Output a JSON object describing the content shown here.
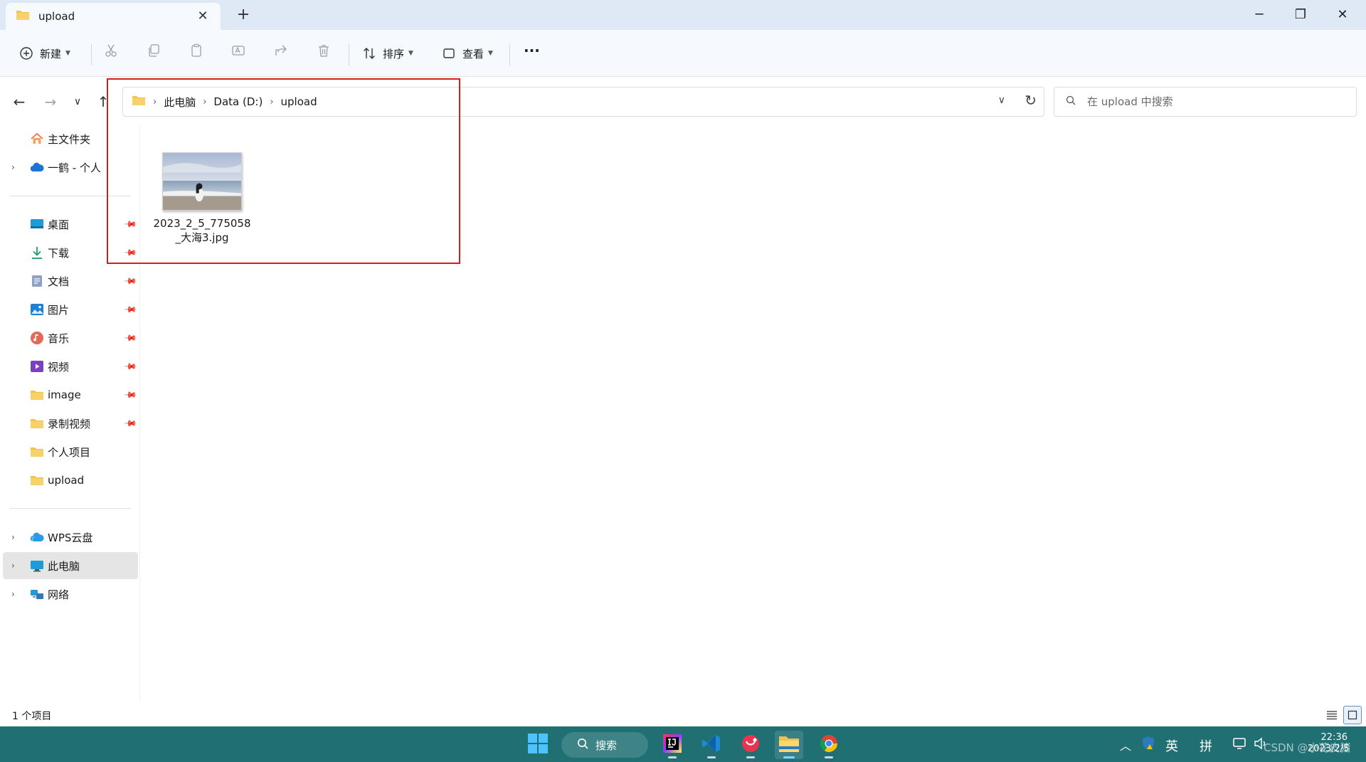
{
  "window": {
    "tab_title": "upload",
    "new_tab": "+",
    "tab_close": "✕",
    "minimize": "─",
    "restore": "❐",
    "close": "✕"
  },
  "toolbar": {
    "new_label": "新建",
    "sort_label": "排序",
    "view_label": "查看",
    "more_label": "···"
  },
  "address": {
    "crumbs": [
      "此电脑",
      "Data (D:)",
      "upload"
    ],
    "search_placeholder": "在 upload 中搜索"
  },
  "sidebar": {
    "home": "主文件夹",
    "onedrive": "一鹤 - 个人",
    "pinned": [
      {
        "label": "桌面",
        "icon": "desktop-icon"
      },
      {
        "label": "下载",
        "icon": "download-icon"
      },
      {
        "label": "文档",
        "icon": "document-icon"
      },
      {
        "label": "图片",
        "icon": "pictures-icon"
      },
      {
        "label": "音乐",
        "icon": "music-icon"
      },
      {
        "label": "视频",
        "icon": "video-icon"
      },
      {
        "label": "image",
        "icon": "folder-icon"
      },
      {
        "label": "录制视频",
        "icon": "folder-icon"
      }
    ],
    "recent": [
      {
        "label": "个人项目",
        "icon": "folder-icon"
      },
      {
        "label": "upload",
        "icon": "folder-icon"
      }
    ],
    "locations": [
      {
        "label": "WPS云盘",
        "icon": "wps-cloud-icon"
      },
      {
        "label": "此电脑",
        "icon": "computer-icon",
        "selected": true
      },
      {
        "label": "网络",
        "icon": "network-icon"
      }
    ]
  },
  "content": {
    "files": [
      {
        "name": "2023_2_5_775058_大海3.jpg",
        "type": "image"
      }
    ]
  },
  "status": {
    "item_count": "1 个项目"
  },
  "taskbar": {
    "search_label": "搜索",
    "ime_lang": "英",
    "ime_mode": "拼",
    "time": "22:36",
    "date": "2023/2/5",
    "watermark": "CSDN @小花皮猪"
  },
  "colors": {
    "titlebar_bg": "#dfe9f6",
    "taskbar_bg": "#1f6f73",
    "highlight_border": "#d81b1b",
    "folder_yellow": "#f2c14e"
  }
}
